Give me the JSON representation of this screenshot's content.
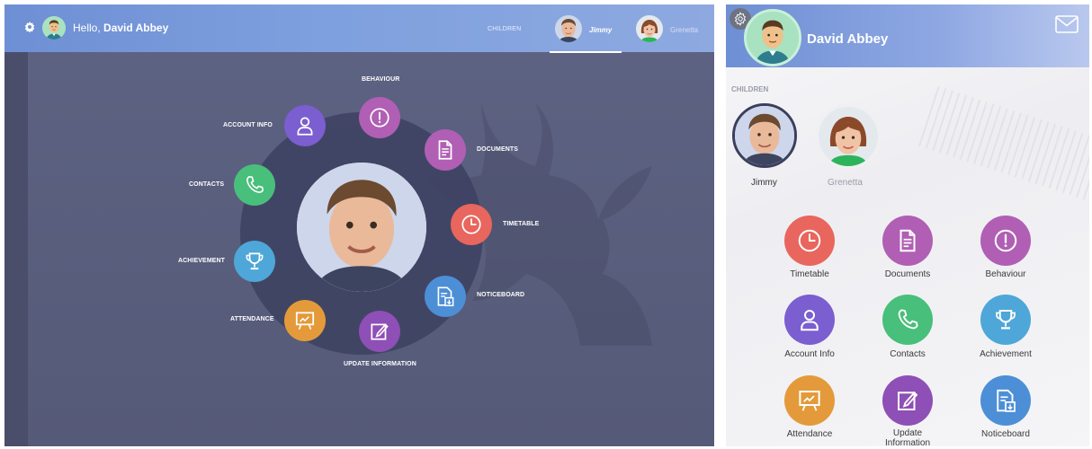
{
  "desktop": {
    "greeting_prefix": "Hello,",
    "user_name": "David Abbey",
    "children_label": "CHILDREN",
    "children": [
      {
        "name": "Jimmy",
        "active": true
      },
      {
        "name": "Grenetta",
        "active": false
      }
    ],
    "actions": [
      {
        "key": "behaviour",
        "label": "BEHAVIOUR",
        "color": "#b05fb4",
        "icon": "exclamation-icon"
      },
      {
        "key": "documents",
        "label": "DOCUMENTS",
        "color": "#b05fb4",
        "icon": "document-icon"
      },
      {
        "key": "timetable",
        "label": "TIMETABLE",
        "color": "#e8665d",
        "icon": "clock-icon"
      },
      {
        "key": "noticeboard",
        "label": "NOTICEBOARD",
        "color": "#4d8fd6",
        "icon": "noticeboard-icon"
      },
      {
        "key": "update",
        "label": "UPDATE INFORMATION",
        "color": "#8e4fb6",
        "icon": "edit-icon"
      },
      {
        "key": "attendance",
        "label": "ATTENDANCE",
        "color": "#e49a3a",
        "icon": "presentation-icon"
      },
      {
        "key": "achievement",
        "label": "ACHIEVEMENT",
        "color": "#4ea7d8",
        "icon": "trophy-icon"
      },
      {
        "key": "contacts",
        "label": "CONTACTS",
        "color": "#48bf7a",
        "icon": "phone-icon"
      },
      {
        "key": "account",
        "label": "ACCOUNT INFO",
        "color": "#7b5ed0",
        "icon": "user-icon"
      }
    ]
  },
  "mobile": {
    "user_name": "David Abbey",
    "children_label": "CHILDREN",
    "children": [
      {
        "name": "Jimmy",
        "active": true
      },
      {
        "name": "Grenetta",
        "active": false
      }
    ],
    "tiles": [
      {
        "label": "Timetable",
        "color": "#e8665d",
        "icon": "clock-icon"
      },
      {
        "label": "Documents",
        "color": "#b05fb4",
        "icon": "document-icon"
      },
      {
        "label": "Behaviour",
        "color": "#b05fb4",
        "icon": "exclamation-icon"
      },
      {
        "label": "Account Info",
        "color": "#7b5ed0",
        "icon": "user-icon"
      },
      {
        "label": "Contacts",
        "color": "#48bf7a",
        "icon": "phone-icon"
      },
      {
        "label": "Achievement",
        "color": "#4ea7d8",
        "icon": "trophy-icon"
      },
      {
        "label": "Attendance",
        "color": "#e49a3a",
        "icon": "presentation-icon"
      },
      {
        "label": "Update Information",
        "color": "#8e4fb6",
        "icon": "edit-icon"
      },
      {
        "label": "Noticeboard",
        "color": "#4d8fd6",
        "icon": "noticeboard-icon"
      }
    ]
  },
  "colors": {
    "header_gradient_start": "#6e8fd4",
    "desktop_background": "#5a5f7e",
    "active_child_text": "#ffffff",
    "inactive_child_text": "#9a9ca8"
  }
}
